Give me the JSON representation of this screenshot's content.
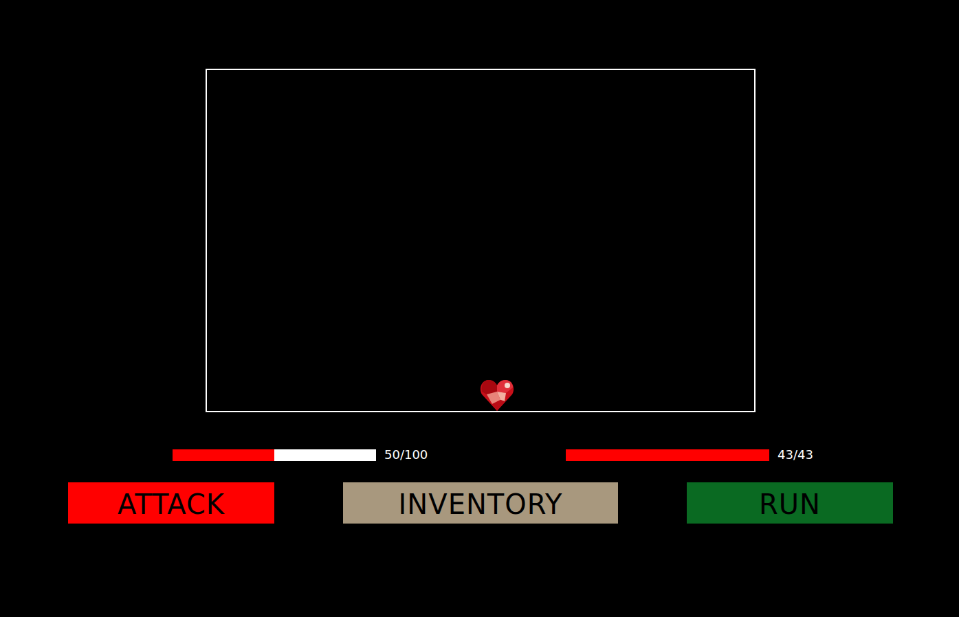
{
  "battle_box": {
    "player_soul": "heart"
  },
  "health_bars": [
    {
      "name": "player",
      "level": 0.5,
      "reading": "50/100"
    },
    {
      "name": "enemy",
      "level": 1,
      "reading": "43/43"
    }
  ],
  "buttons": [
    {
      "label": "ATTACK",
      "color": "#ff0000"
    },
    {
      "label": "INVENTORY",
      "color": "#a8987e"
    },
    {
      "label": "RUN",
      "color": "#0a6a22"
    }
  ]
}
